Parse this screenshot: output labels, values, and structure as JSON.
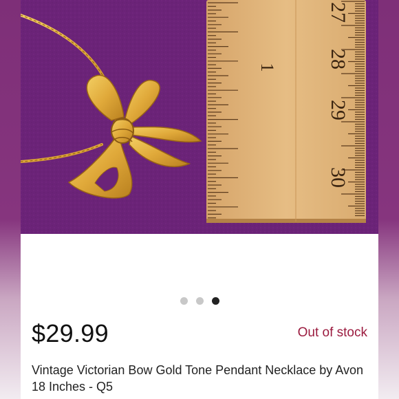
{
  "listing": {
    "price": "$29.99",
    "stock_status": "Out of stock",
    "title": "Vintage Victorian Bow Gold Tone Pendant Necklace by Avon 18 Inches - Q5"
  },
  "photo": {
    "ruler_numbers_in": [
      "1"
    ],
    "ruler_numbers_cm": [
      "27",
      "28",
      "29",
      "30"
    ]
  },
  "carousel": {
    "total": 3,
    "active_index": 2
  },
  "colors": {
    "background": "#6b2378",
    "stock_status": "#9b1b3f",
    "active_dot": "#222222",
    "inactive_dot": "#c8c8c8",
    "ruler_wood": "#e0b67a",
    "gold": "#e0a93a"
  }
}
